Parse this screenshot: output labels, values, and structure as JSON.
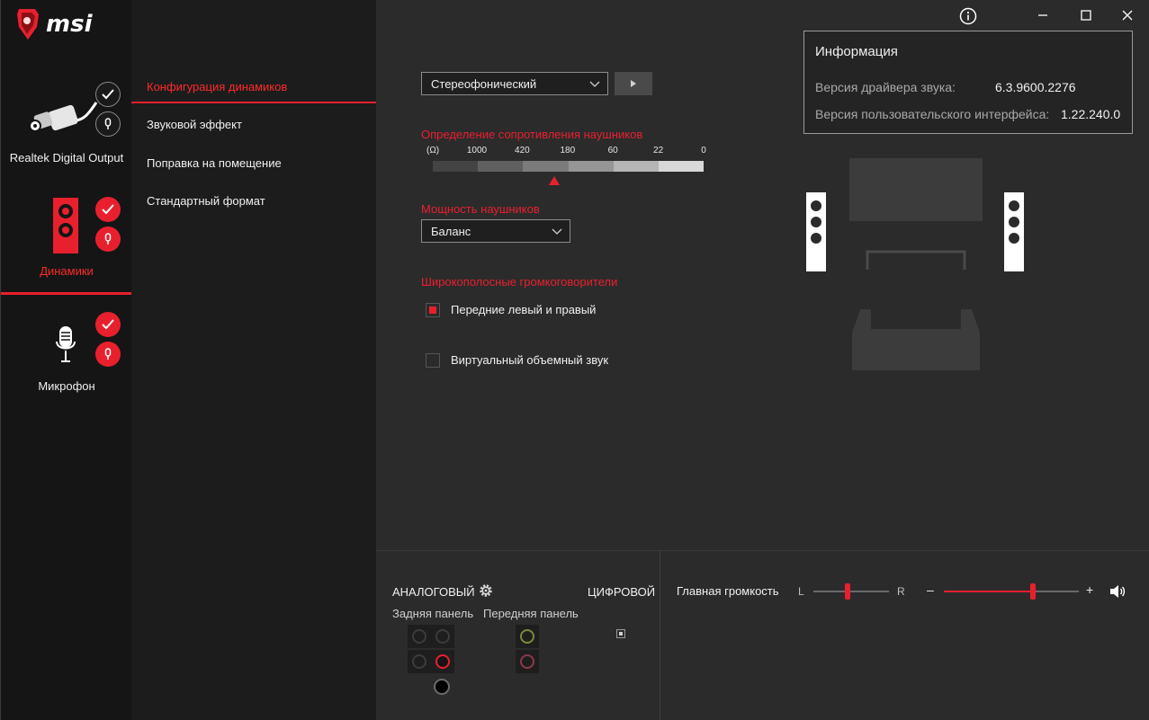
{
  "window": {
    "info_icon": "info-icon",
    "minimize_icon": "minimize-icon",
    "maximize_icon": "maximize-icon",
    "close_icon": "close-icon"
  },
  "brand": {
    "name": "msi",
    "color": "#e8202e"
  },
  "devices": [
    {
      "label": "Realtek Digital Output",
      "active": false
    },
    {
      "label": "Динамики",
      "active": true
    },
    {
      "label": "Микрофон",
      "active": false
    }
  ],
  "menu": {
    "items": [
      {
        "label": "Конфигурация динамиков",
        "active": true
      },
      {
        "label": "Звуковой эффект",
        "active": false
      },
      {
        "label": "Поправка на помещение",
        "active": false
      },
      {
        "label": "Стандартный формат",
        "active": false
      }
    ]
  },
  "speaker_config": {
    "mode_value": "Стереофонический",
    "impedance_title": "Определение сопротивления наушников",
    "impedance_unit": "(Ω)",
    "impedance_ticks": [
      "1000",
      "420",
      "180",
      "60",
      "22",
      "0"
    ],
    "impedance_marker": 0.45,
    "power_title": "Мощность наушников",
    "power_value": "Баланс",
    "fullrange_title": "Широкополосные громкоговорители",
    "front_lr_label": "Передние левый и правый",
    "front_lr_checked": true,
    "virtual_surround_label": "Виртуальный объемный звук",
    "virtual_surround_checked": false
  },
  "info": {
    "title": "Информация",
    "driver_label": "Версия драйвера звука:",
    "driver_value": "6.3.9600.2276",
    "ui_label": "Версия пользовательского интерфейса:",
    "ui_value": "1.22.240.0"
  },
  "connectors": {
    "analog_label": "АНАЛОГОВЫЙ",
    "digital_label": "ЦИФРОВОЙ",
    "rear_label": "Задняя панель",
    "front_label": "Передняя панель"
  },
  "volume": {
    "label": "Главная громкость",
    "left_label": "L",
    "right_label": "R",
    "minus": "–",
    "plus": "+",
    "balance": 0.45,
    "level": 0.66
  }
}
